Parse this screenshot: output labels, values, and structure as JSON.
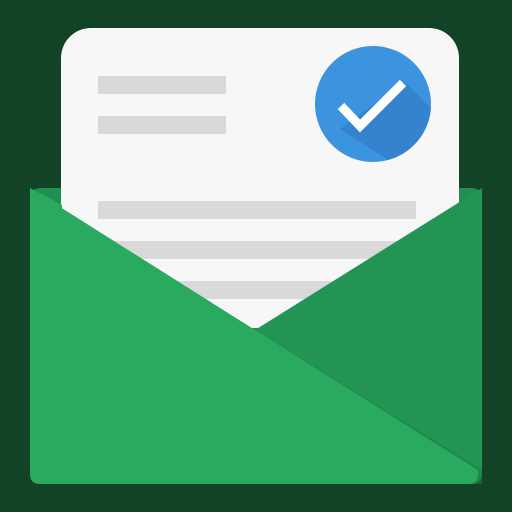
{
  "app_icon": {
    "name": "mail-verified-icon",
    "colors": {
      "background": "#134326",
      "paper": "#F7F7F7",
      "text_lines": "#D9D9D9",
      "envelope_front": "#2AAA5E",
      "envelope_flap": "#259353",
      "badge": "#3C94DF",
      "badge_shadow": "#2F78BF",
      "check": "#FFFFFF"
    }
  }
}
